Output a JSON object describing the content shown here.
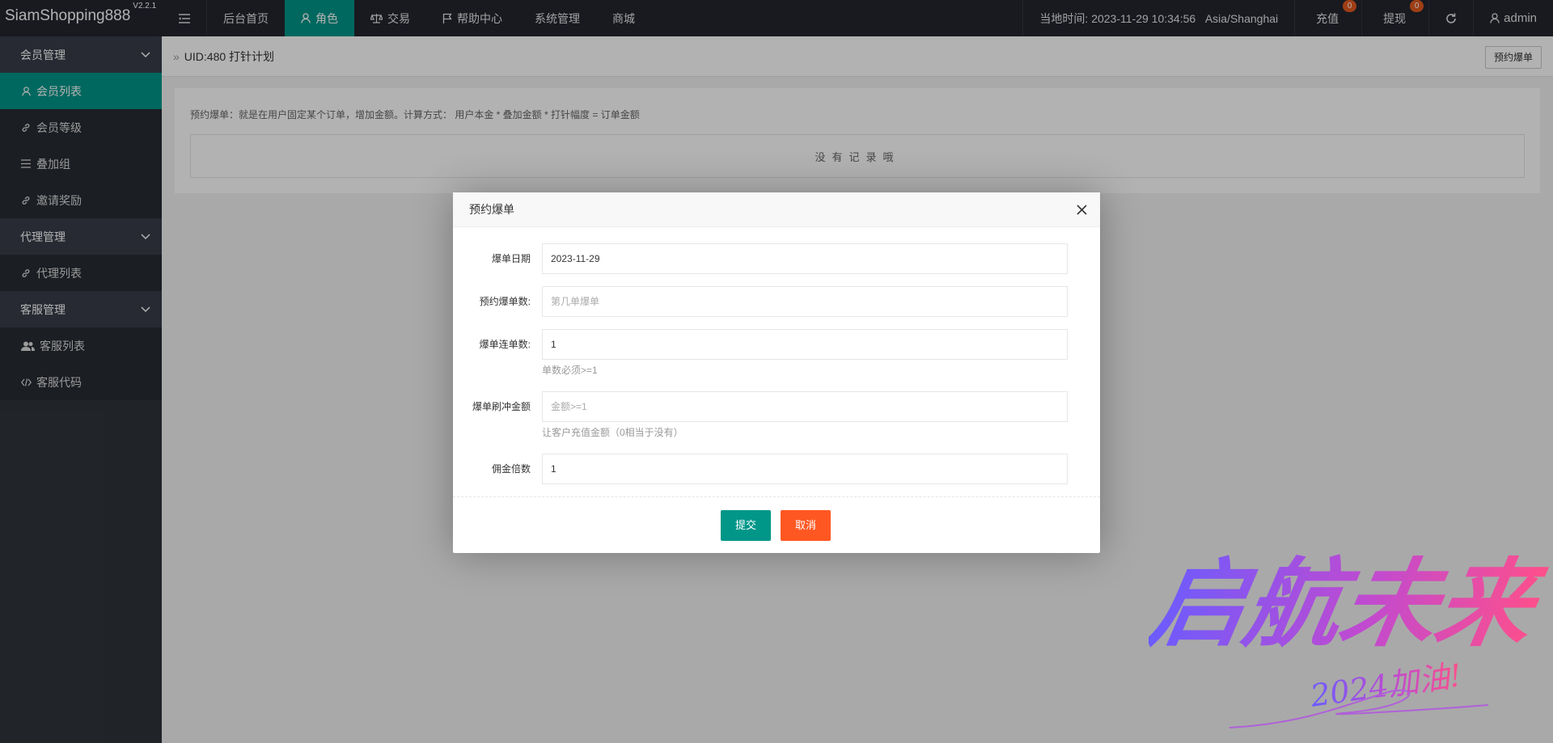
{
  "header": {
    "logo": "SiamShopping888",
    "version": "V2.2.1",
    "nav": [
      {
        "label": "后台首页",
        "icon": "",
        "active": false
      },
      {
        "label": "角色",
        "icon": "user-icon",
        "active": true
      },
      {
        "label": "交易",
        "icon": "scale-icon",
        "active": false
      },
      {
        "label": "帮助中心",
        "icon": "flag-icon",
        "active": false
      },
      {
        "label": "系统管理",
        "icon": "",
        "active": false
      },
      {
        "label": "商城",
        "icon": "",
        "active": false
      }
    ],
    "clock": "当地时间: 2023-11-29 10:34:56",
    "timezone": "Asia/Shanghai",
    "recharge": {
      "label": "充值",
      "count": "0"
    },
    "withdraw": {
      "label": "提现",
      "count": "0"
    },
    "user": "admin"
  },
  "sidebar": {
    "groups": [
      {
        "label": "会员管理",
        "items": [
          {
            "label": "会员列表",
            "icon": "user-icon",
            "active": true
          },
          {
            "label": "会员等级",
            "icon": "link-icon",
            "active": false
          },
          {
            "label": "叠加组",
            "icon": "list-icon",
            "active": false
          },
          {
            "label": "邀请奖励",
            "icon": "link-icon",
            "active": false
          }
        ]
      },
      {
        "label": "代理管理",
        "items": [
          {
            "label": "代理列表",
            "icon": "link-icon",
            "active": false
          }
        ]
      },
      {
        "label": "客服管理",
        "items": [
          {
            "label": "客服列表",
            "icon": "users-icon",
            "active": false
          },
          {
            "label": "客服代码",
            "icon": "code-icon",
            "active": false
          }
        ]
      }
    ]
  },
  "main": {
    "breadcrumb": "UID:480 打针计划",
    "top_button": "预约爆单",
    "tip": "预约爆单：就是在用户固定某个订单，增加金额。计算方式： 用户本金 * 叠加金额 * 打针幅度 = 订单金额",
    "empty": "没有记录哦"
  },
  "modal": {
    "title": "预约爆单",
    "fields": [
      {
        "label": "爆单日期",
        "value": "2023-11-29",
        "placeholder": "",
        "hint": ""
      },
      {
        "label": "预约爆单数:",
        "value": "",
        "placeholder": "第几单爆单",
        "hint": ""
      },
      {
        "label": "爆单连单数:",
        "value": "1",
        "placeholder": "",
        "hint": "单数必须>=1"
      },
      {
        "label": "爆单刷冲金额",
        "value": "",
        "placeholder": "金额>=1",
        "hint": "让客户充值金额（0相当于没有）"
      },
      {
        "label": "佣金倍数",
        "value": "1",
        "placeholder": "",
        "hint": ""
      }
    ],
    "submit": "提交",
    "cancel": "取消"
  },
  "watermark": {
    "title": "启航未来",
    "subtitle": "2024加油!"
  },
  "colors": {
    "accent": "#009688",
    "danger": "#ff5722",
    "header": "#23262e",
    "sidebar": "#2f3339"
  }
}
